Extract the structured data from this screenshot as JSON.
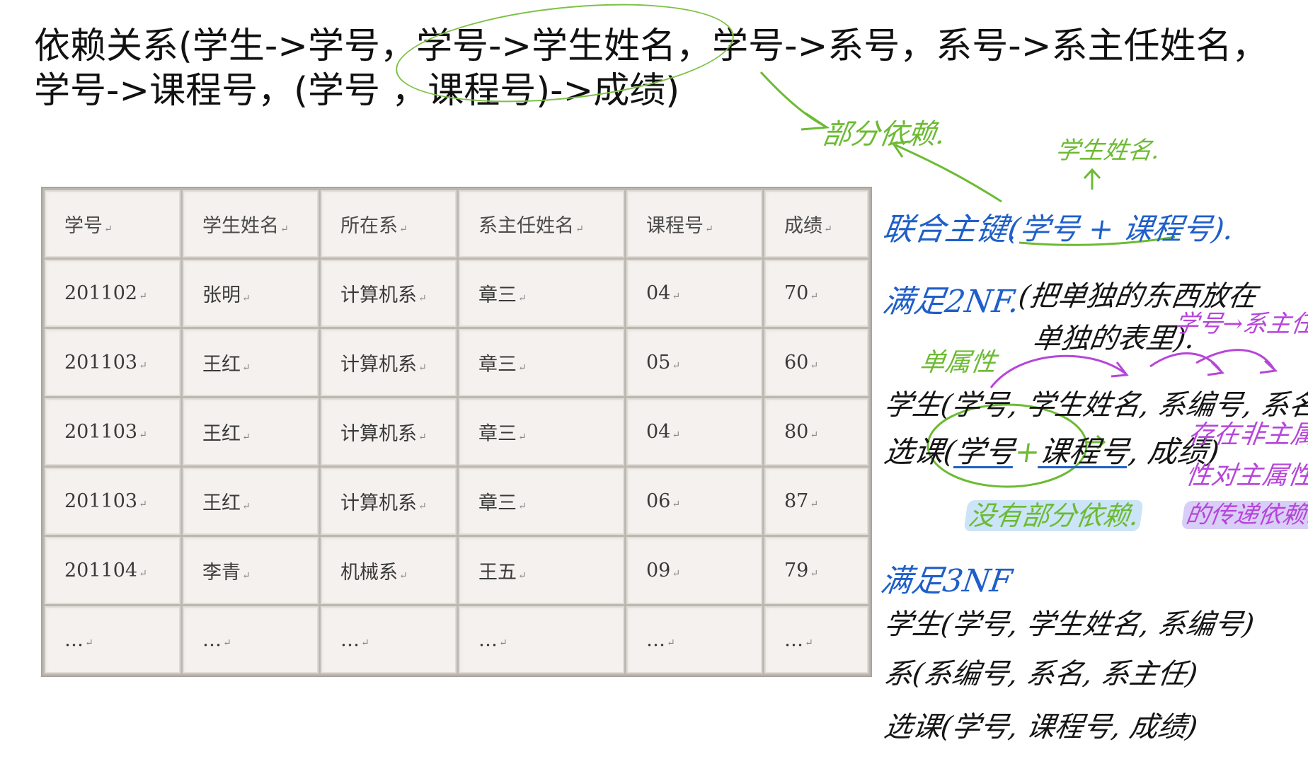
{
  "heading": {
    "line1": "依赖关系(学生->学号，学号->学生姓名，学号->系号，系号->系主任姓名，",
    "line2": "学号->课程号，(学号 ，课程号)->成绩)"
  },
  "table": {
    "headers": [
      "学号",
      "学生姓名",
      "所在系",
      "系主任姓名",
      "课程号",
      "成绩"
    ],
    "rows": [
      [
        "201102",
        "张明",
        "计算机系",
        "章三",
        "04",
        "70"
      ],
      [
        "201103",
        "王红",
        "计算机系",
        "章三",
        "05",
        "60"
      ],
      [
        "201103",
        "王红",
        "计算机系",
        "章三",
        "04",
        "80"
      ],
      [
        "201103",
        "王红",
        "计算机系",
        "章三",
        "06",
        "87"
      ],
      [
        "201104",
        "李青",
        "机械系",
        "王五",
        "09",
        "79"
      ],
      [
        "…",
        "…",
        "…",
        "…",
        "…",
        "…"
      ]
    ],
    "cell_mark": "↵"
  },
  "notes": {
    "partial_dependency": "部分依赖.",
    "student_name_top": "学生姓名.",
    "composite_key_label": "联合主键.",
    "composite_key_value": "(学号 + 课程号).",
    "satisfy_2nf": "满足2NF.",
    "nf2_explain_1": "(把单独的东西放在",
    "nf2_explain_2": "单独的表里).",
    "single_attr": "单属性",
    "id_to_head": "学号→系主任",
    "student_relation": "学生(学号, 学生姓名, 系编号, 系名, 系主任)",
    "course_relation_prefix": "选课(",
    "course_relation_key1": "学号",
    "course_relation_plus": "+",
    "course_relation_key2": "课程号",
    "course_relation_suffix": ", 成绩)",
    "no_partial": "没有部分依赖.",
    "transitive_1": "存在非主属",
    "transitive_2": "性对主属性",
    "transitive_3": "的传递依赖.",
    "satisfy_3nf": "满足3NF",
    "nf3_student": "学生(学号, 学生姓名, 系编号)",
    "nf3_dept": "系(系编号, 系名, 系主任)",
    "nf3_course": "选课(学号, 课程号, 成绩)"
  },
  "colors": {
    "green_ink": "#6cbb32",
    "blue_ink": "#1f5fc9",
    "black_ink": "#151515",
    "purple_ink": "#b646d9"
  }
}
